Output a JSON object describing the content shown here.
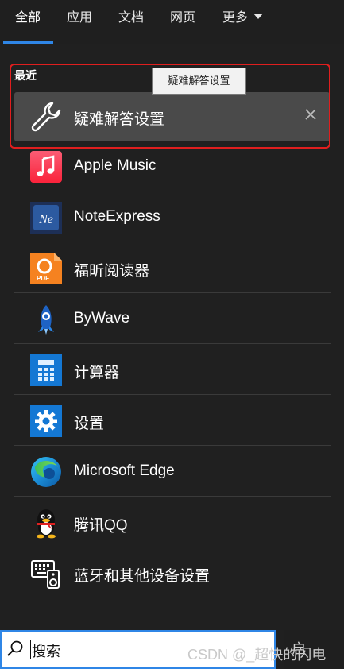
{
  "tabs": [
    {
      "label": "全部",
      "active": true
    },
    {
      "label": "应用"
    },
    {
      "label": "文档"
    },
    {
      "label": "网页"
    },
    {
      "label": "更多"
    }
  ],
  "recent": {
    "title": "最近",
    "item_label": "疑难解答设置",
    "tooltip": "疑难解答设置"
  },
  "apps": [
    {
      "label": "Apple Music",
      "icon": "apple-music-icon"
    },
    {
      "label": "NoteExpress",
      "icon": "noteexpress-icon"
    },
    {
      "label": "福昕阅读器",
      "icon": "foxit-reader-icon"
    },
    {
      "label": "ByWave",
      "icon": "bywave-icon"
    },
    {
      "label": "计算器",
      "icon": "calculator-icon"
    },
    {
      "label": "设置",
      "icon": "settings-gear-icon"
    },
    {
      "label": "Microsoft Edge",
      "icon": "edge-icon"
    },
    {
      "label": "腾讯QQ",
      "icon": "qq-penguin-icon"
    },
    {
      "label": "蓝牙和其他设备设置",
      "icon": "bluetooth-devices-icon"
    }
  ],
  "search": {
    "value": "搜索",
    "right_stub": "启"
  },
  "watermark": "CSDN @_超快的闪电",
  "colors": {
    "accent": "#2f86e6",
    "highlight": "#e01e1e",
    "background": "#202020"
  }
}
